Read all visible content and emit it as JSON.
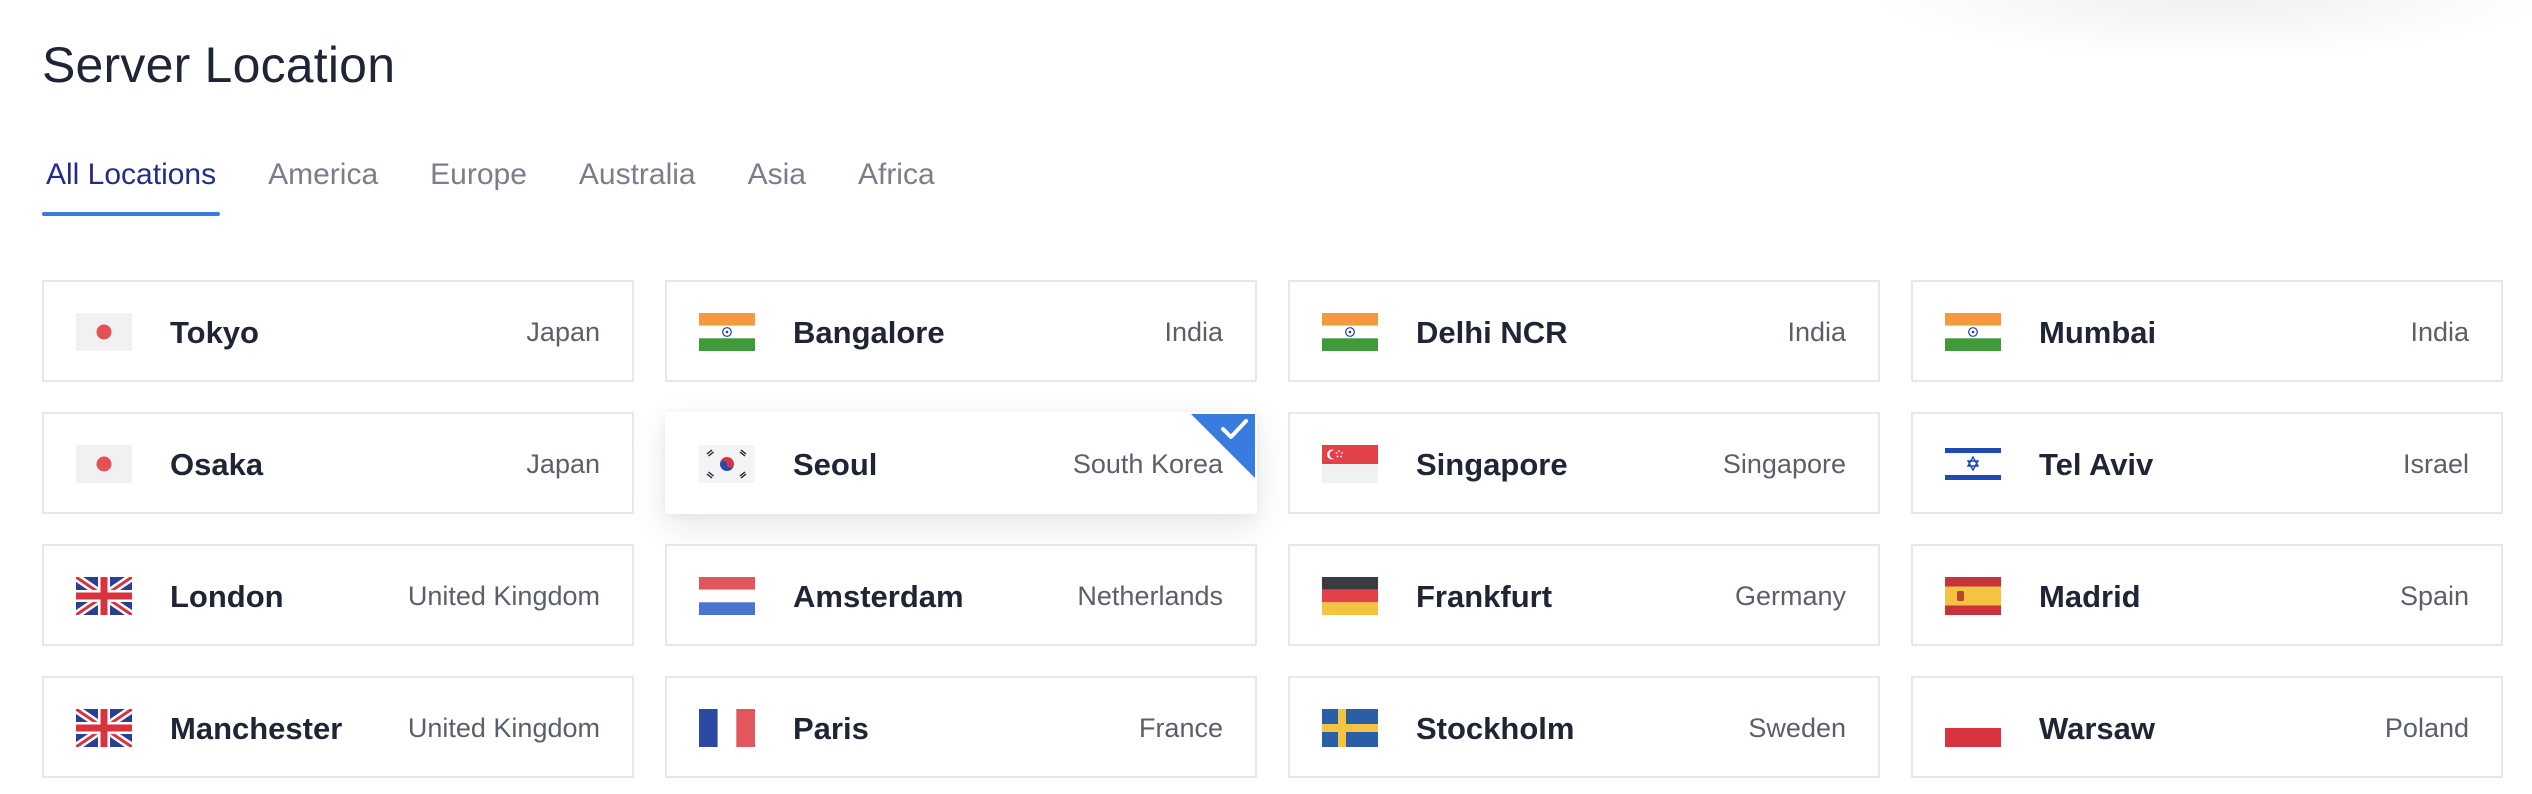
{
  "page": {
    "title": "Server Location"
  },
  "tabs": [
    {
      "label": "All Locations",
      "active": true
    },
    {
      "label": "America"
    },
    {
      "label": "Europe"
    },
    {
      "label": "Australia"
    },
    {
      "label": "Asia"
    },
    {
      "label": "Africa"
    }
  ],
  "locations": [
    {
      "city": "Tokyo",
      "country": "Japan",
      "flag": "japan-flag-icon"
    },
    {
      "city": "Bangalore",
      "country": "India",
      "flag": "india-flag-icon"
    },
    {
      "city": "Delhi NCR",
      "country": "India",
      "flag": "india-flag-icon"
    },
    {
      "city": "Mumbai",
      "country": "India",
      "flag": "india-flag-icon"
    },
    {
      "city": "Osaka",
      "country": "Japan",
      "flag": "japan-flag-icon"
    },
    {
      "city": "Seoul",
      "country": "South Korea",
      "flag": "south-korea-flag-icon",
      "selected": true
    },
    {
      "city": "Singapore",
      "country": "Singapore",
      "flag": "singapore-flag-icon"
    },
    {
      "city": "Tel Aviv",
      "country": "Israel",
      "flag": "israel-flag-icon"
    },
    {
      "city": "London",
      "country": "United Kingdom",
      "flag": "uk-flag-icon"
    },
    {
      "city": "Amsterdam",
      "country": "Netherlands",
      "flag": "netherlands-flag-icon"
    },
    {
      "city": "Frankfurt",
      "country": "Germany",
      "flag": "germany-flag-icon"
    },
    {
      "city": "Madrid",
      "country": "Spain",
      "flag": "spain-flag-icon"
    },
    {
      "city": "Manchester",
      "country": "United Kingdom",
      "flag": "uk-flag-icon"
    },
    {
      "city": "Paris",
      "country": "France",
      "flag": "france-flag-icon"
    },
    {
      "city": "Stockholm",
      "country": "Sweden",
      "flag": "sweden-flag-icon"
    },
    {
      "city": "Warsaw",
      "country": "Poland",
      "flag": "poland-flag-icon"
    }
  ],
  "colors": {
    "accent": "#3a7be0",
    "active_tab_text": "#232b8c",
    "check_badge": "#3a7be0"
  }
}
